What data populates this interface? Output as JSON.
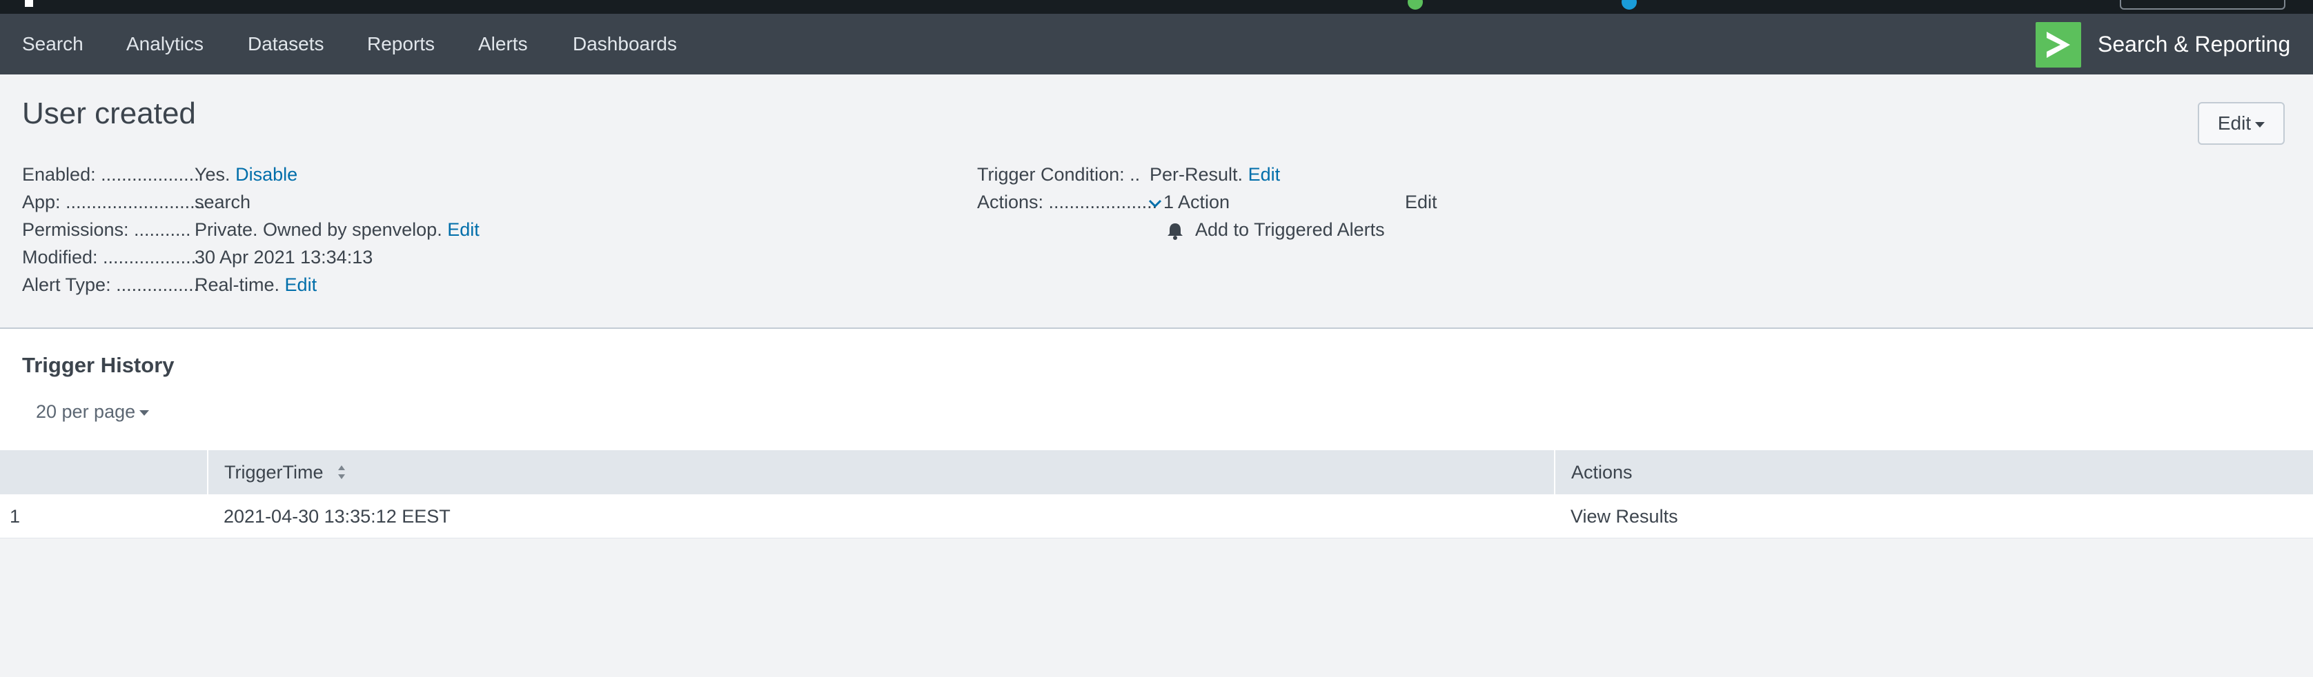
{
  "nav": {
    "items": [
      "Search",
      "Analytics",
      "Datasets",
      "Reports",
      "Alerts",
      "Dashboards"
    ],
    "app_title": "Search & Reporting"
  },
  "alert": {
    "title": "User created",
    "edit_button": "Edit",
    "enabled": {
      "label": "Enabled: ...................",
      "value": "Yes.",
      "action": "Disable"
    },
    "app": {
      "label": "App: ...........................",
      "value": "search"
    },
    "permissions": {
      "label": "Permissions: ...........",
      "value": "Private. Owned by spenvelop.",
      "action": "Edit"
    },
    "modified": {
      "label": "Modified: ..................",
      "value": "30 Apr 2021 13:34:13"
    },
    "alert_type": {
      "label": "Alert Type: ................",
      "value": "Real-time.",
      "action": "Edit"
    },
    "trigger_condition": {
      "label": "Trigger Condition: ..",
      "value": "Per-Result.",
      "action": "Edit"
    },
    "actions": {
      "label": "Actions: .....................",
      "value": "1 Action",
      "action": "Edit",
      "items": [
        "Add to Triggered Alerts"
      ]
    }
  },
  "history": {
    "title": "Trigger History",
    "per_page": "20 per page",
    "columns": [
      "",
      "TriggerTime",
      "Actions"
    ],
    "rows": [
      {
        "index": "1",
        "trigger_time": "2021-04-30 13:35:12 EEST",
        "action": "View Results"
      }
    ]
  },
  "colors": {
    "nav_bg": "#3c444d",
    "system_bar_bg": "#171d21",
    "logo_green": "#5cc05c",
    "link_blue": "#006eaa",
    "page_bg": "#f2f3f5",
    "table_header_bg": "#e1e6eb"
  },
  "icons": {
    "app_logo": "chevron-right-logo-icon",
    "actions_toggle": "chevron-down-icon",
    "alert_action": "bell-icon",
    "sort": "sort-icon",
    "per_page_caret": "caret-down-icon"
  }
}
